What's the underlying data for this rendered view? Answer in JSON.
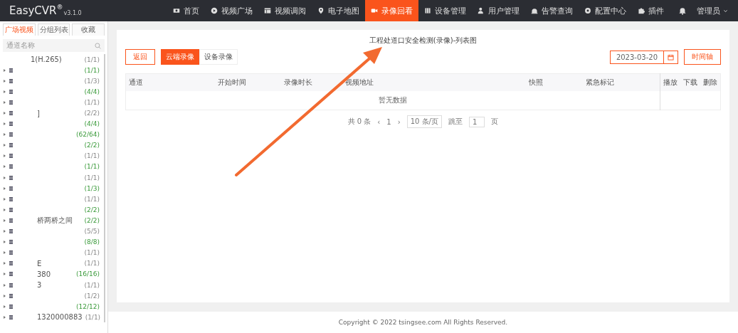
{
  "header": {
    "logo": "EasyCVR",
    "logo_mark": "®",
    "version": "v3.1.0",
    "nav": [
      {
        "label": "首页",
        "selected": false
      },
      {
        "label": "视频广场",
        "selected": false
      },
      {
        "label": "视频调阅",
        "selected": false
      },
      {
        "label": "电子地图",
        "selected": false
      },
      {
        "label": "录像回看",
        "selected": true
      },
      {
        "label": "设备管理",
        "selected": false
      },
      {
        "label": "用户管理",
        "selected": false
      },
      {
        "label": "告警查询",
        "selected": false
      },
      {
        "label": "配置中心",
        "selected": false
      },
      {
        "label": "插件",
        "selected": false
      }
    ],
    "user": "管理员"
  },
  "sidebar": {
    "tabs": [
      {
        "label": "广场视频",
        "selected": true
      },
      {
        "label": "分组列表",
        "selected": false
      },
      {
        "label": "收藏",
        "selected": false
      }
    ],
    "search": {
      "placeholder": "通道名称"
    },
    "items": [
      {
        "name": "1(H.265)",
        "count": "(1/1)",
        "highlighted": false
      },
      {
        "count": "(1/1)",
        "highlighted": true
      },
      {
        "count": "(1/3)",
        "highlighted": false
      },
      {
        "count": "(4/4)",
        "highlighted": true
      },
      {
        "count": "(1/1)",
        "highlighted": false
      },
      {
        "name": "]",
        "count": "(2/2)",
        "highlighted": false
      },
      {
        "count": "(4/4)",
        "highlighted": true
      },
      {
        "count": "(62/64)",
        "highlighted": true
      },
      {
        "count": "(2/2)",
        "highlighted": true
      },
      {
        "count": "(1/1)",
        "highlighted": false
      },
      {
        "count": "(1/1)",
        "highlighted": true
      },
      {
        "count": "(1/1)",
        "highlighted": false
      },
      {
        "count": "(1/3)",
        "highlighted": true
      },
      {
        "count": "(1/1)",
        "highlighted": false
      },
      {
        "count": "(2/2)",
        "highlighted": true
      },
      {
        "name": "桥两桥之间",
        "count": "(2/2)",
        "highlighted": true
      },
      {
        "count": "(5/5)",
        "highlighted": false
      },
      {
        "count": "(8/8)",
        "highlighted": true
      },
      {
        "count": "(1/1)",
        "highlighted": false
      },
      {
        "name": "E",
        "count": "(1/1)",
        "highlighted": false
      },
      {
        "name": "380",
        "count": "(16/16)",
        "highlighted": true
      },
      {
        "name": "3",
        "count": "(1/1)",
        "highlighted": false
      },
      {
        "count": "(1/2)",
        "highlighted": false
      },
      {
        "count": "(12/12)",
        "highlighted": true
      },
      {
        "name": "1320000883",
        "count": "(1/1)",
        "highlighted": false
      }
    ]
  },
  "main": {
    "title": "工程处道口安全检测(录像)-列表图",
    "back_button": "返回",
    "source_tabs": [
      {
        "label": "云端录像",
        "selected": true
      },
      {
        "label": "设备录像",
        "selected": false
      }
    ],
    "date": "2023-03-20",
    "timeline_button": "时间轴",
    "table": {
      "columns": [
        "通道",
        "开始时间",
        "录像时长",
        "视频地址",
        "快照",
        "紧急标记"
      ],
      "action_columns": [
        "播放",
        "下载",
        "删除"
      ],
      "empty": "暂无数据"
    },
    "pagination": {
      "total": "共 0 条",
      "prev": "‹",
      "page": "1",
      "next": "›",
      "page_size": "10 条/页",
      "jump_label": "跳至",
      "jump_value": "1",
      "page_unit": "页"
    }
  },
  "footer": "Copyright © 2022 tsingsee.com All Rights Reserved."
}
